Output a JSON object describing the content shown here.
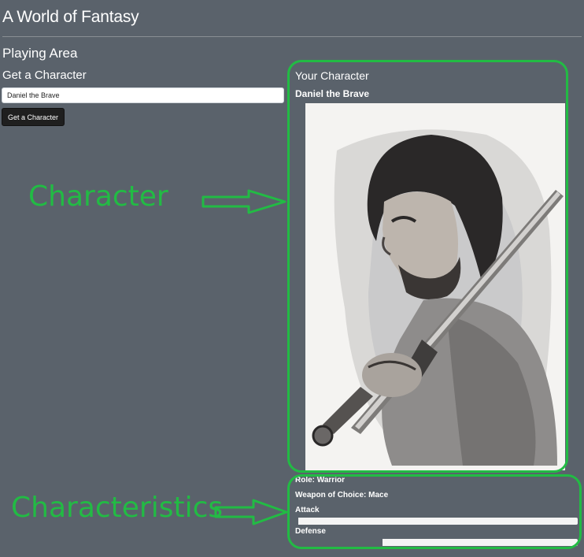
{
  "app": {
    "title": "A World of Fantasy"
  },
  "playing_area": {
    "heading": "Playing Area",
    "get_character": {
      "heading": "Get a Character",
      "input_value": "Daniel the Brave",
      "button_label": "Get a Character"
    }
  },
  "character": {
    "heading": "Your Character",
    "name": "Daniel the Brave",
    "role": "Role: Warrior",
    "weapon": "Weapon of Choice: Mace",
    "attack_label": "Attack",
    "attack_level": 0.99,
    "defense_label": "Defense",
    "defense_level": 0.69
  },
  "annotations": {
    "character_label": "Character",
    "characteristics_label": "Characteristics",
    "color": "#22bb44"
  }
}
